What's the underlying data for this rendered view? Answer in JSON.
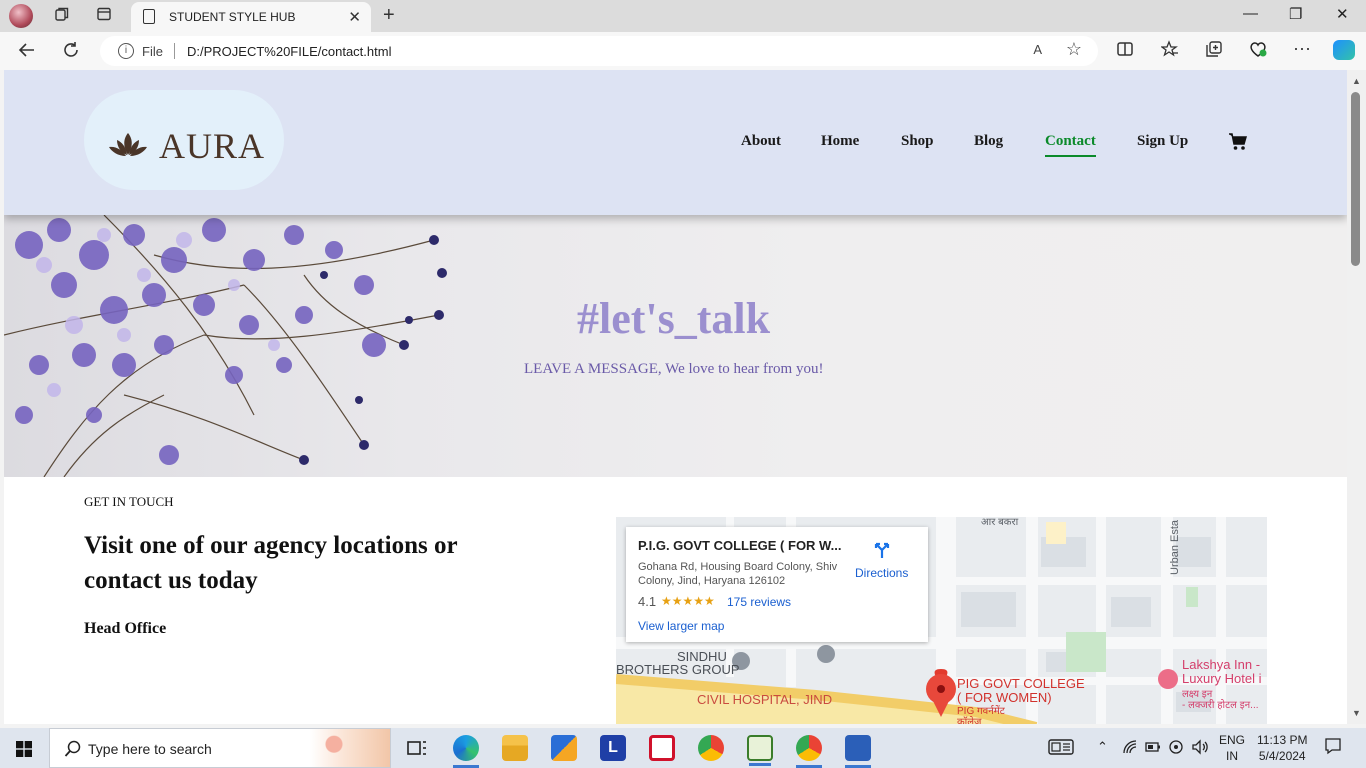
{
  "browser": {
    "tab_title": "STUDENT STYLE HUB",
    "close_tab": "✕",
    "new_tab": "+",
    "file_label": "File",
    "url": "D:/PROJECT%20FILE/contact.html",
    "read_aloud": "A",
    "window_min": "—",
    "window_max": "❐",
    "window_close": "✕"
  },
  "site": {
    "brand": "AURA",
    "nav": [
      {
        "label": "About"
      },
      {
        "label": "Home"
      },
      {
        "label": "Shop"
      },
      {
        "label": "Blog"
      },
      {
        "label": "Contact",
        "active": true
      },
      {
        "label": "Sign Up"
      }
    ],
    "hero": {
      "title": "#let's_talk",
      "subtitle": "LEAVE A MESSAGE, We love to hear from you!"
    },
    "contact": {
      "eyebrow": "GET IN TOUCH",
      "heading": "Visit one of our agency locations or contact us today",
      "office_heading": "Head Office"
    },
    "map": {
      "place_name": "P.I.G. GOVT COLLEGE ( FOR W...",
      "address": "Gohana Rd, Housing Board Colony, Shiv Colony, Jind, Haryana 126102",
      "rating": "4.1",
      "stars": "★★★★★",
      "reviews": "175 reviews",
      "larger_map": "View larger map",
      "directions": "Directions",
      "labels": {
        "sindhu": "SINDHU",
        "brothers": "BROTHERS GROUP",
        "hospital": "CIVIL HOSPITAL, JIND",
        "college1": "PIG GOVT COLLEGE",
        "college2": "( FOR WOMEN)",
        "college_hi": "PIG गवर्नमेंट",
        "college_hi2": "कॉलेज",
        "hotel1": "Lakshya Inn -",
        "hotel2": "Luxury Hotel i",
        "hotel_hi1": "लक्ष्य इन",
        "hotel_hi2": "- लक्जरी होटल इन...",
        "urban": "Urban Esta",
        "top_hi": "आर बकरा"
      }
    }
  },
  "taskbar": {
    "search_placeholder": "Type here to search",
    "lang_line1": "ENG",
    "lang_line2": "IN",
    "time": "11:13 PM",
    "date": "5/4/2024"
  },
  "colors": {
    "header_bg": "#dde3f3",
    "hero_title": "#9b8fcf",
    "nav_active": "#0b8a2a"
  }
}
